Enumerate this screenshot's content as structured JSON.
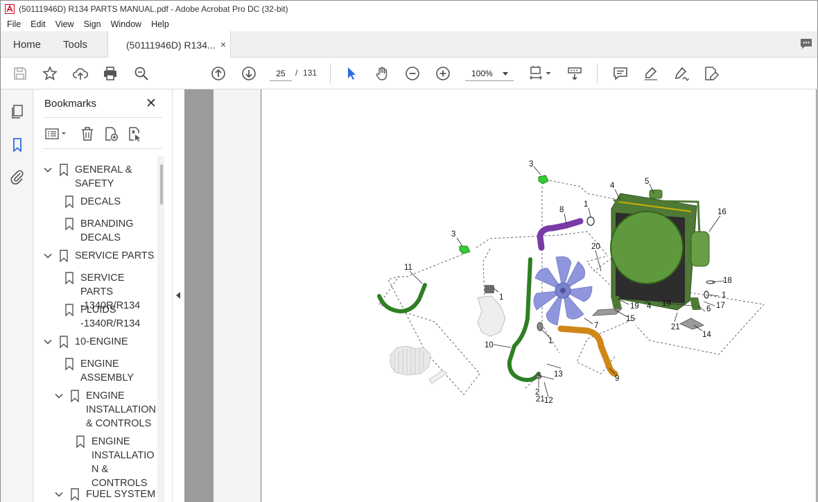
{
  "window": {
    "title": "(50111946D) R134 PARTS MANUAL.pdf - Adobe Acrobat Pro DC (32-bit)"
  },
  "menu": [
    "File",
    "Edit",
    "View",
    "Sign",
    "Window",
    "Help"
  ],
  "tabs": {
    "home": "Home",
    "tools": "Tools",
    "document": "(50111946D) R134...",
    "close": "×"
  },
  "toolbar": {
    "page_current": "25",
    "page_sep": "/",
    "page_total": "131",
    "zoom": "100%"
  },
  "bookmarks": {
    "title": "Bookmarks",
    "close": "✕",
    "items": [
      {
        "label": "GENERAL & SAFETY",
        "lines": [
          "GENERAL &",
          "SAFETY"
        ]
      },
      {
        "label": "DECALS",
        "lines": [
          "DECALS"
        ]
      },
      {
        "label": "BRANDING DECALS",
        "lines": [
          "BRANDING",
          "DECALS"
        ]
      },
      {
        "label": "SERVICE PARTS",
        "lines": [
          "SERVICE PARTS"
        ]
      },
      {
        "label": "SERVICE PARTS -1340R/R134",
        "lines": [
          "SERVICE PARTS",
          "-1340R/R134"
        ]
      },
      {
        "label": "FLUIDS -1340R/R134",
        "lines": [
          "FLUIDS",
          "-1340R/R134"
        ]
      },
      {
        "label": "10-ENGINE",
        "lines": [
          "10-ENGINE"
        ]
      },
      {
        "label": "ENGINE ASSEMBLY",
        "lines": [
          "ENGINE",
          "ASSEMBLY"
        ]
      },
      {
        "label": "ENGINE INSTALLATION & CONTROLS",
        "lines": [
          "ENGINE",
          "INSTALLATION",
          "& CONTROLS"
        ]
      },
      {
        "label": "ENGINE INSTALLATION & CONTROLS",
        "lines": [
          "ENGINE",
          "INSTALLATIO",
          "N &",
          "CONTROLS"
        ]
      },
      {
        "label": "FUEL SYSTEM",
        "lines": [
          "FUEL SYSTEM"
        ]
      }
    ]
  },
  "diagram": {
    "callouts": [
      "3",
      "4",
      "5",
      "8",
      "1",
      "16",
      "3",
      "20",
      "11",
      "1",
      "18",
      "1",
      "19",
      "4",
      "19",
      "17",
      "6",
      "15",
      "7",
      "21",
      "14",
      "1",
      "10",
      "13",
      "21",
      "9",
      "2",
      "12"
    ]
  },
  "colors": {
    "green_part": "#3d8a2e",
    "radiator_green": "#4f7a35",
    "fan_blue": "#8f96dc",
    "hose_purple": "#7a3aa6",
    "hose_orange": "#d08a18",
    "bright_green": "#33cc33",
    "acrobat_blue": "#2d6cdf"
  }
}
